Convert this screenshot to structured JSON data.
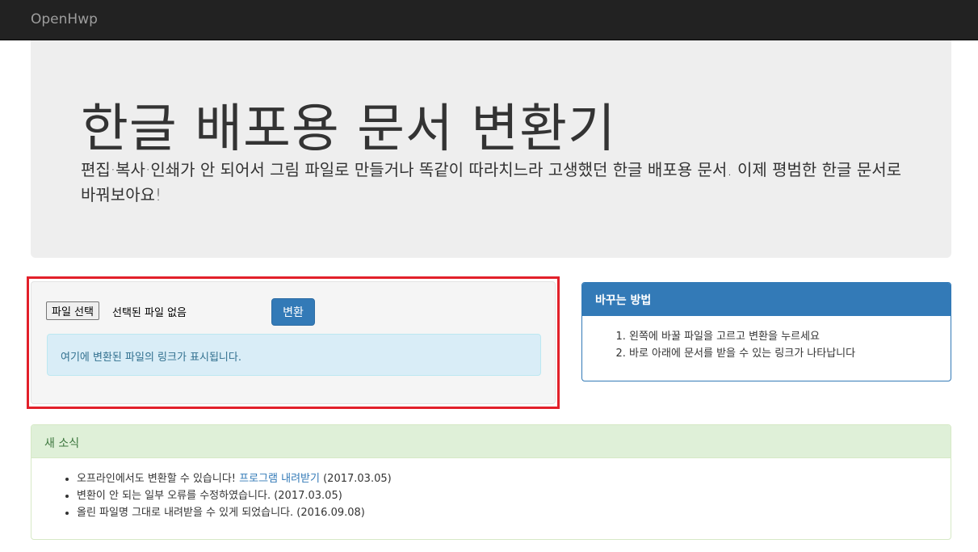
{
  "navbar": {
    "brand": "OpenHwp"
  },
  "jumbotron": {
    "title": "한글 배포용 문서 변환기",
    "lead": "편집·복사·인쇄가 안 되어서 그림 파일로 만들거나 똑같이 따라치느라 고생했던 한글 배포용 문서. 이제 평범한 한글 문서로 바꿔보아요!"
  },
  "upload": {
    "file_button": "파일 선택",
    "file_status": "선택된 파일 없음",
    "convert_button": "변환",
    "link_placeholder": "여기에 변환된 파일의 링크가 표시됩니다."
  },
  "howto": {
    "title": "바꾸는 방법",
    "steps": [
      "왼쪽에 바꿀 파일을 고르고 변환을 누르세요",
      "바로 아래에 문서를 받을 수 있는 링크가 나타납니다"
    ]
  },
  "news": {
    "title": "새 소식",
    "items": [
      {
        "text": "오프라인에서도 변환할 수 있습니다!",
        "link": "프로그램 내려받기",
        "date": "(2017.03.05)"
      },
      {
        "text": "변환이 안 되는 일부 오류를 수정하였습니다.",
        "date": "(2017.03.05)"
      },
      {
        "text": "올린 파일명 그대로 내려받을 수 있게 되었습니다.",
        "date": "(2016.09.08)"
      }
    ]
  }
}
